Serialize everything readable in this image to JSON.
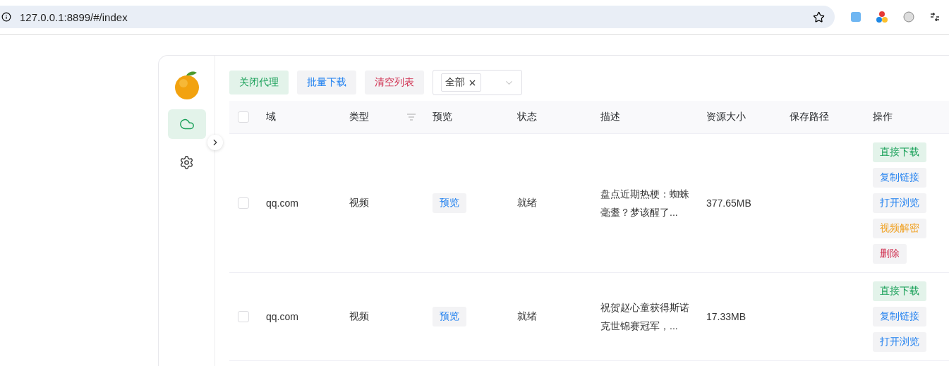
{
  "browser": {
    "url": "127.0.0.1:8899/#/index"
  },
  "sidebar": {
    "items": [
      {
        "kind": "cloud",
        "selected": true
      },
      {
        "kind": "settings",
        "selected": false
      }
    ]
  },
  "toolbar": {
    "buttons": [
      {
        "label": "关闭代理",
        "kind": "green"
      },
      {
        "label": "批量下载",
        "kind": "blue"
      },
      {
        "label": "清空列表",
        "kind": "red"
      }
    ],
    "filter": {
      "tags": [
        {
          "label": "全部"
        }
      ]
    }
  },
  "table": {
    "select_all": {
      "checked": false
    },
    "columns": [
      {
        "label": "域",
        "filter": false
      },
      {
        "label": "类型",
        "filter": true
      },
      {
        "label": "预览",
        "filter": false
      },
      {
        "label": "状态",
        "filter": false
      },
      {
        "label": "描述",
        "filter": false
      },
      {
        "label": "资源大小",
        "filter": false
      },
      {
        "label": "保存路径",
        "filter": false
      },
      {
        "label": "操作",
        "filter": false
      }
    ],
    "rows": [
      {
        "checked": false,
        "domain": "qq.com",
        "type": "视频",
        "preview": "预览",
        "status": "就绪",
        "description": "盘点近期热梗：蜘蛛毫耋？梦该醒了...",
        "size": "377.65MB",
        "actions": [
          {
            "label": "直接下载",
            "kind": "green"
          },
          {
            "label": "复制链接",
            "kind": "blue"
          },
          {
            "label": "打开浏览",
            "kind": "blue"
          },
          {
            "label": "视频解密",
            "kind": "orange"
          },
          {
            "label": "删除",
            "kind": "red"
          }
        ]
      },
      {
        "checked": false,
        "domain": "qq.com",
        "type": "视频",
        "preview": "预览",
        "status": "就绪",
        "description": "祝贺赵心童获得斯诺克世锦赛冠军，...",
        "size": "17.33MB",
        "actions": [
          {
            "label": "直接下载",
            "kind": "green"
          },
          {
            "label": "复制链接",
            "kind": "blue"
          },
          {
            "label": "打开浏览",
            "kind": "blue"
          }
        ]
      }
    ]
  }
}
